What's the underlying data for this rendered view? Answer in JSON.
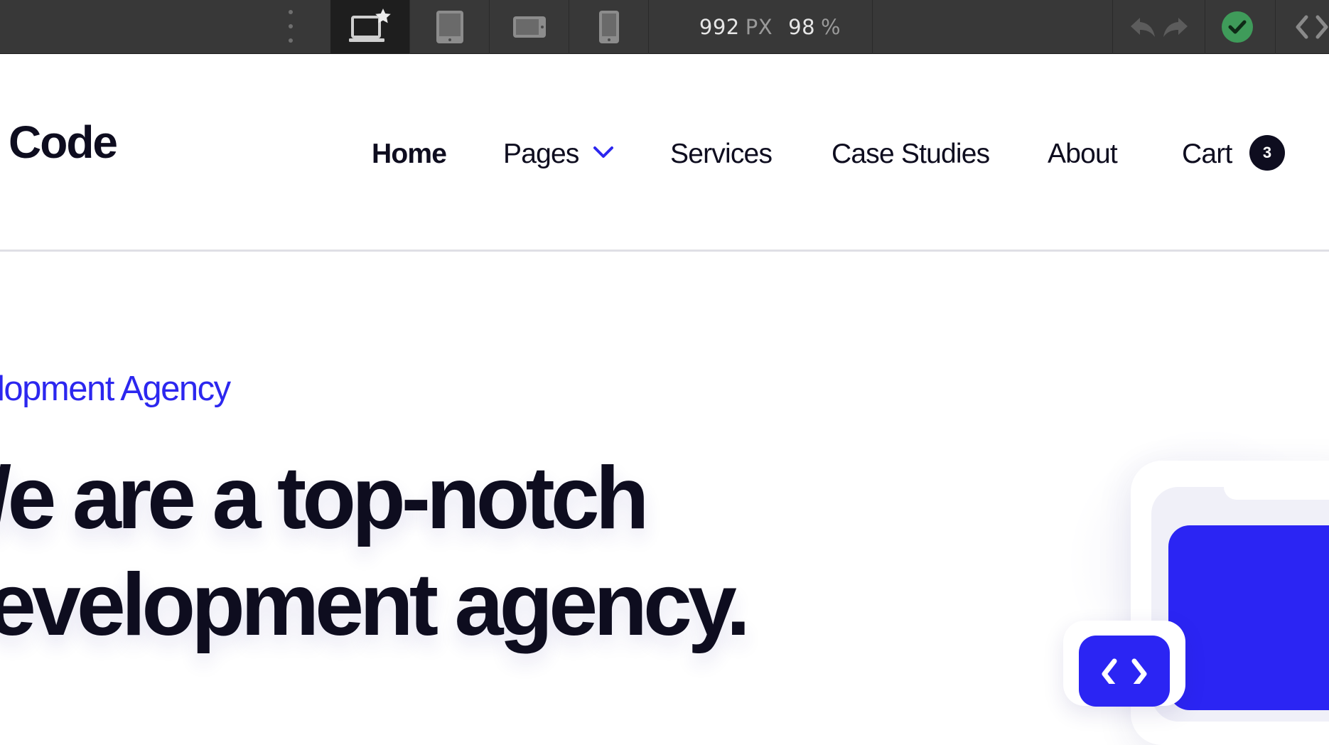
{
  "toolbar": {
    "breakpoints": [
      {
        "name": "desktop-base",
        "icon": "laptop-star-icon",
        "active": true
      },
      {
        "name": "tablet",
        "icon": "tablet-icon",
        "active": false
      },
      {
        "name": "mobile-landscape",
        "icon": "phone-landscape-icon",
        "active": false
      },
      {
        "name": "mobile-portrait",
        "icon": "phone-portrait-icon",
        "active": false
      }
    ],
    "width_value": "992",
    "width_unit": "PX",
    "zoom_value": "98",
    "zoom_unit": "%",
    "icons": {
      "undo": "undo-icon",
      "redo": "redo-icon",
      "status": "check-circle-icon",
      "code": "code-brackets-icon"
    },
    "status_color": "#3f9b5a"
  },
  "site": {
    "logo": "Code",
    "nav": {
      "home": "Home",
      "pages": "Pages",
      "services": "Services",
      "case_studies": "Case Studies",
      "about": "About",
      "cart": "Cart",
      "cart_count": "3"
    },
    "hero": {
      "eyebrow": "lopment Agency",
      "headline_line1": "/e are a top-notch",
      "headline_line2": "evelopment agency."
    }
  },
  "colors": {
    "accent": "#2c27ef",
    "text_dark": "#0e0d1f",
    "toolbar_bg": "#383838"
  }
}
